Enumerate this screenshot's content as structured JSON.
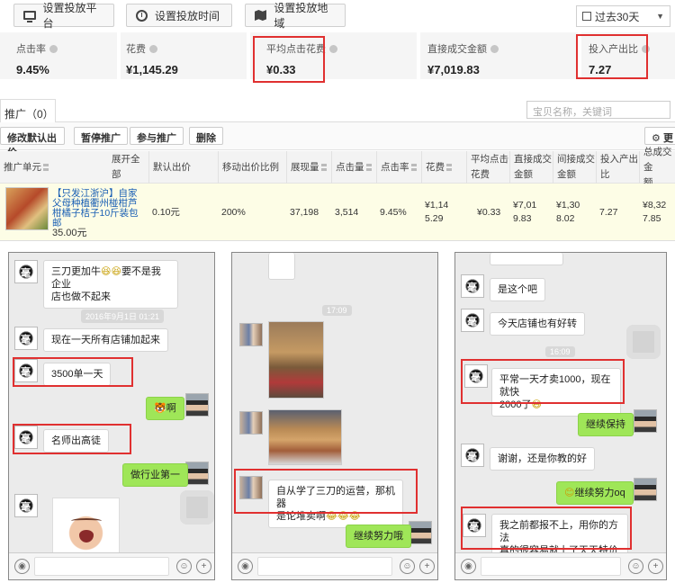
{
  "toolbar": {
    "platform_label": "设置投放平台",
    "time_label": "设置投放时间",
    "region_label": "设置投放地域",
    "period_label": "过去30天"
  },
  "stats": [
    {
      "label": "点击率",
      "value": "9.45%"
    },
    {
      "label": "花费",
      "value": "¥1,145.29"
    },
    {
      "label": "平均点击花费",
      "value": "¥0.33"
    },
    {
      "label": "直接成交金额",
      "value": "¥7,019.83"
    },
    {
      "label": "投入产出比",
      "value": "7.27"
    }
  ],
  "tab": {
    "label": "推广（0）"
  },
  "search": {
    "placeholder": "宝贝名称，关键词"
  },
  "actions": {
    "modify_bid": "修改默认出价",
    "pause": "暂停推广",
    "join": "参与推广",
    "delete": "删除",
    "more": "更"
  },
  "table": {
    "headers": {
      "unit": "推广单元",
      "expand": "展开全部",
      "default_bid": "默认出价",
      "mobile_ratio": "移动出价比例",
      "impressions": "展现量",
      "clicks": "点击量",
      "ctr": "点击率",
      "cost": "花费",
      "avg_cpc_1": "平均点击",
      "avg_cpc_2": "花费",
      "direct_1": "直接成交",
      "direct_2": "金额",
      "indirect_1": "间接成交",
      "indirect_2": "金额",
      "roi_1": "投入产出",
      "roi_2": "比",
      "total_1": "总成交金",
      "total_2": "额"
    },
    "row": {
      "title": "【只发江浙沪】自家父母种植衢州椪柑芦柑橘子桔子10斤装包邮",
      "price": "35.00元",
      "default_bid": "0.10元",
      "mobile_ratio": "200%",
      "impressions": "37,198",
      "clicks": "3,514",
      "ctr": "9.45%",
      "cost_1": "¥1,14",
      "cost_2": "5.29",
      "avg_cpc": "¥0.33",
      "direct_1": "¥7,01",
      "direct_2": "9.83",
      "indirect_1": "¥1,30",
      "indirect_2": "8.02",
      "roi": "7.27",
      "total_1": "¥8,32",
      "total_2": "7.85"
    }
  },
  "chat1": {
    "msg1_line1": "三刀更加牛",
    "msg1_line1b": "要不是我企业",
    "msg1_line2": "店也做不起来",
    "timestamp": "2016年9月1日 01:21",
    "msg2": "现在一天所有店铺加起来",
    "msg3": "3500单一天",
    "msg4": "啊",
    "msg5": "名师出高徒",
    "msg6": "做行业第一"
  },
  "chat2": {
    "timestamp": "17:09",
    "msg1_line1": "自从学了三刀的运营，那机器",
    "msg1_line2": "是论堆卖啊",
    "msg2": "继续努力哦"
  },
  "chat3": {
    "msg1": "是这个吧",
    "msg2": "今天店铺也有好转",
    "timestamp": "16:09",
    "msg3_line1": "平常一天才卖1000，现在就快",
    "msg3_line2": "2000了",
    "msg4": "继续保持",
    "msg5": "谢谢，还是你教的好",
    "msg6": "继续努力oq",
    "msg7_line1": "我之前都报不上，用你的方法",
    "msg7_line2": "真的很容易就上了天天特价"
  },
  "icons": {
    "emoji": "😊",
    "voice": "🔊",
    "smile": "☺",
    "plus": "+"
  },
  "colors": {
    "highlight": "#e03030",
    "bubble_right": "#9fe658",
    "link": "#1a5fb4"
  }
}
